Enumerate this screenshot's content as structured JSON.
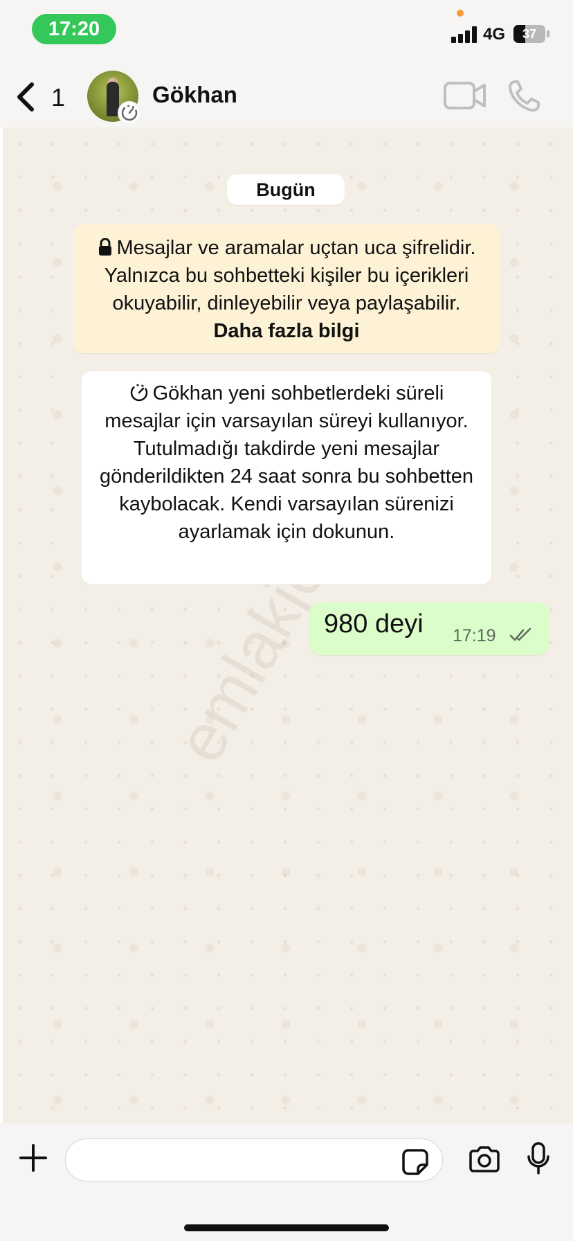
{
  "status_bar": {
    "time": "17:20",
    "network": "4G",
    "battery_level": "37",
    "battery_percent": 37,
    "colors": {
      "time_pill": "#34c759",
      "camera_indicator": "#f29c38"
    }
  },
  "header": {
    "back_count": "1",
    "contact_name": "Gökhan",
    "icons": {
      "back": "chevron-left-icon",
      "video": "video-camera-icon",
      "call": "phone-icon",
      "timer": "disappearing-timer-icon"
    }
  },
  "chat": {
    "date_label": "Bugün",
    "encryption_notice": {
      "text": "Mesajlar ve aramalar uçtan uca şifrelidir. Yalnızca bu sohbetteki kişiler bu içerikleri okuyabilir, dinleyebilir veya paylaşabilir.",
      "link": "Daha fazla bilgi"
    },
    "disappearing_notice": "Gökhan  yeni sohbetlerdeki süreli mesajlar için varsayılan süreyi kullanıyor. Tutulmadığı takdirde yeni mesajlar gönderildikten 24 saat sonra bu sohbetten kaybolacak. Kendi varsayılan sürenizi ayarlamak için dokunun.",
    "messages": [
      {
        "text": "980 deyi",
        "time": "17:19",
        "status": "read",
        "outgoing": true
      }
    ],
    "watermark": "emlakjet.com",
    "colors": {
      "outgoing_bubble": "#dbfdca",
      "notice_bg": "#fdf2d6",
      "background": "#f4efe6"
    }
  },
  "input_bar": {
    "placeholder": "",
    "icons": {
      "add": "plus-icon",
      "sticker": "sticker-icon",
      "camera": "camera-icon",
      "mic": "microphone-icon"
    }
  }
}
